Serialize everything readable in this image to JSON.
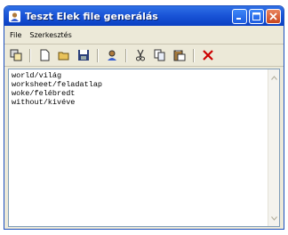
{
  "window": {
    "title": "Teszt Elek file generálás"
  },
  "menu": {
    "items": [
      "File",
      "Szerkesztés"
    ]
  },
  "toolbar": {
    "buttons": [
      "export-icon",
      "new-document-icon",
      "open-folder-icon",
      "save-disk-icon",
      "user-icon",
      "cut-scissors-icon",
      "copy-icon",
      "paste-icon",
      "delete-x-icon"
    ]
  },
  "editor": {
    "lines": [
      "world/világ",
      "worksheet/feladatlap",
      "woke/felébredt",
      "without/kivéve"
    ]
  },
  "colors": {
    "titlebar": "#1a55d8",
    "close_button": "#c9461d",
    "delete_icon": "#cc0000"
  }
}
